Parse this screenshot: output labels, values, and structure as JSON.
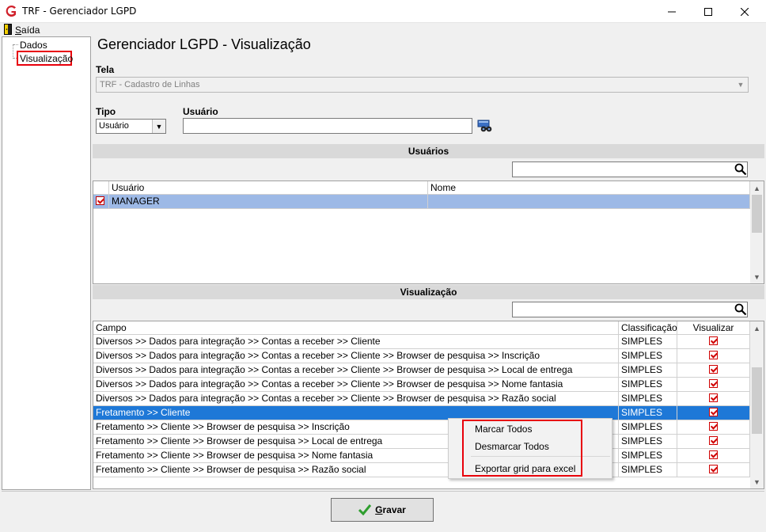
{
  "window": {
    "title": "TRF - Gerenciador LGPD"
  },
  "menu": {
    "exit_prefix": "S",
    "exit_rest": "aída"
  },
  "tree": {
    "items": [
      {
        "label": "Dados"
      },
      {
        "label": "Visualização"
      }
    ]
  },
  "page": {
    "title": "Gerenciador LGPD - Visualização"
  },
  "form": {
    "tela_label": "Tela",
    "tela_value": "TRF - Cadastro de Linhas",
    "tipo_label": "Tipo",
    "tipo_value": "Usuário",
    "usuario_label": "Usuário",
    "usuario_value": ""
  },
  "usuarios": {
    "header": "Usuários",
    "filter_value": "",
    "columns": [
      "Usuário",
      "Nome"
    ],
    "rows": [
      {
        "usuario": "MANAGER",
        "nome": "",
        "checked": true
      }
    ]
  },
  "visualizacao": {
    "header": "Visualização",
    "filter_value": "",
    "columns": [
      "Campo",
      "Classificação",
      "Visualizar"
    ],
    "rows": [
      {
        "campo": "Diversos >> Dados para integração >> Contas a receber >> Cliente",
        "classificacao": "SIMPLES",
        "visualizar": true
      },
      {
        "campo": "Diversos >> Dados para integração >> Contas a receber >> Cliente >> Browser de pesquisa >> Inscrição",
        "classificacao": "SIMPLES",
        "visualizar": true
      },
      {
        "campo": "Diversos >> Dados para integração >> Contas a receber >> Cliente >> Browser de pesquisa >> Local de entrega",
        "classificacao": "SIMPLES",
        "visualizar": true
      },
      {
        "campo": "Diversos >> Dados para integração >> Contas a receber >> Cliente >> Browser de pesquisa >> Nome fantasia",
        "classificacao": "SIMPLES",
        "visualizar": true
      },
      {
        "campo": "Diversos >> Dados para integração >> Contas a receber >> Cliente >> Browser de pesquisa >> Razão social",
        "classificacao": "SIMPLES",
        "visualizar": true
      },
      {
        "campo": "Fretamento >> Cliente",
        "classificacao": "SIMPLES",
        "visualizar": true,
        "selected": true
      },
      {
        "campo": "Fretamento >> Cliente >> Browser de pesquisa >> Inscrição",
        "classificacao": "SIMPLES",
        "visualizar": true
      },
      {
        "campo": "Fretamento >> Cliente >> Browser de pesquisa >> Local de entrega",
        "classificacao": "SIMPLES",
        "visualizar": true
      },
      {
        "campo": "Fretamento >> Cliente >> Browser de pesquisa >> Nome fantasia",
        "classificacao": "SIMPLES",
        "visualizar": true
      },
      {
        "campo": "Fretamento >> Cliente >> Browser de pesquisa >> Razão social",
        "classificacao": "SIMPLES",
        "visualizar": true
      }
    ]
  },
  "context_menu": {
    "items": [
      {
        "label": "Marcar Todos"
      },
      {
        "label": "Desmarcar Todos"
      },
      {
        "label": "Exportar grid para excel"
      }
    ]
  },
  "footer": {
    "save_prefix": "G",
    "save_rest": "ravar"
  },
  "colors": {
    "selection": "#1e78d7",
    "highlight_box": "#e8000b",
    "app_icon": "#d0202a"
  }
}
